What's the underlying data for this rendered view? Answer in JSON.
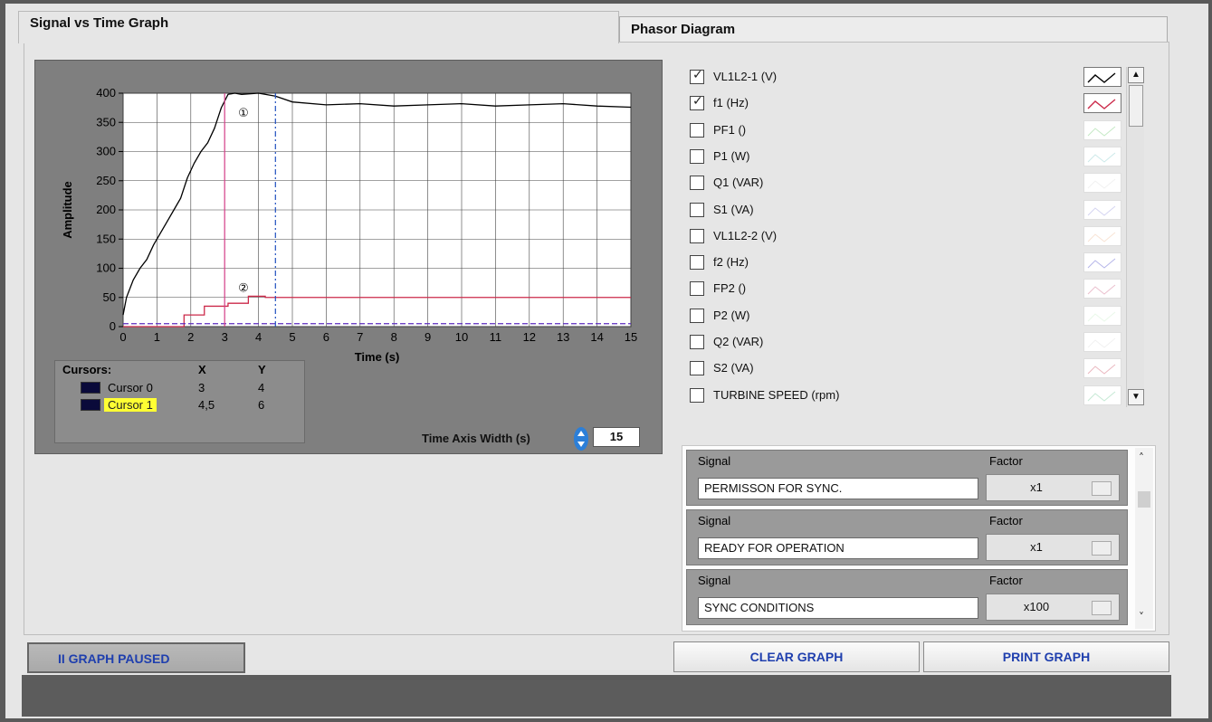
{
  "tabs": {
    "signal_vs_time": "Signal vs Time Graph",
    "phasor": "Phasor Diagram"
  },
  "graph": {
    "y_label": "Amplitude",
    "x_label": "Time (s)",
    "y_ticks": [
      "400",
      "350",
      "300",
      "250",
      "200",
      "150",
      "100",
      "50",
      "0"
    ],
    "x_ticks": [
      "0",
      "1",
      "2",
      "3",
      "4",
      "5",
      "6",
      "7",
      "8",
      "9",
      "10",
      "11",
      "12",
      "13",
      "14",
      "15"
    ],
    "marker1": "①",
    "marker2": "②"
  },
  "chart_data": {
    "type": "line",
    "xlabel": "Time (s)",
    "ylabel": "Amplitude",
    "xlim": [
      0,
      15
    ],
    "ylim": [
      0,
      400
    ],
    "grid": true,
    "series": [
      {
        "name": "VL1L2-1 (V)",
        "color": "#000000",
        "x": [
          0,
          0.1,
          0.3,
          0.5,
          0.7,
          0.9,
          1.1,
          1.3,
          1.5,
          1.7,
          1.9,
          2.1,
          2.3,
          2.5,
          2.7,
          2.9,
          3.1,
          3.3,
          3.5,
          4.0,
          4.5,
          5.0,
          6.0,
          7.0,
          8.0,
          9.0,
          10.0,
          11.0,
          12.0,
          13.0,
          14.0,
          15.0
        ],
        "y": [
          20,
          50,
          80,
          100,
          115,
          140,
          160,
          180,
          200,
          220,
          255,
          280,
          300,
          315,
          340,
          375,
          398,
          400,
          398,
          400,
          395,
          385,
          380,
          382,
          378,
          380,
          382,
          378,
          380,
          382,
          378,
          376
        ]
      },
      {
        "name": "f1 (Hz)",
        "color": "#cc2a4a",
        "x": [
          0,
          1.8,
          1.8,
          2.4,
          2.4,
          3.1,
          3.1,
          3.7,
          3.7,
          4.2,
          4.2,
          15
        ],
        "y": [
          0,
          0,
          20,
          20,
          35,
          35,
          40,
          40,
          52,
          52,
          50,
          50
        ]
      },
      {
        "name": "PF1 ()",
        "color": "#5b2bbf",
        "x": [
          0,
          15
        ],
        "y": [
          5,
          5
        ]
      }
    ]
  },
  "cursors": {
    "title": "Cursors:",
    "col_x": "X",
    "col_y": "Y",
    "rows": [
      {
        "name": "Cursor 0",
        "x": "3",
        "y": "4"
      },
      {
        "name": "Cursor 1",
        "x": "4,5",
        "y": "6"
      }
    ]
  },
  "time_axis": {
    "label": "Time Axis Width (s)",
    "value": "15"
  },
  "signals": [
    {
      "label": "VL1L2-1 (V)",
      "checked": true
    },
    {
      "label": "f1 (Hz)",
      "checked": true
    },
    {
      "label": "PF1 ()",
      "checked": false
    },
    {
      "label": "P1 (W)",
      "checked": false
    },
    {
      "label": "Q1 (VAR)",
      "checked": false
    },
    {
      "label": "S1 (VA)",
      "checked": false
    },
    {
      "label": "VL1L2-2 (V)",
      "checked": false
    },
    {
      "label": "f2 (Hz)",
      "checked": false
    },
    {
      "label": "FP2 ()",
      "checked": false
    },
    {
      "label": "P2 (W)",
      "checked": false
    },
    {
      "label": "Q2 (VAR)",
      "checked": false
    },
    {
      "label": "S2 (VA)",
      "checked": false
    },
    {
      "label": "TURBINE SPEED (rpm)",
      "checked": false
    }
  ],
  "legend_colors": [
    "#000000",
    "#cc2a4a",
    "#7fcf7f",
    "#8fcfcf",
    "#e0e0e0",
    "#9f9fdf",
    "#efc0a0",
    "#5a5acf",
    "#d07090",
    "#cfefcf",
    "#e0e0e0",
    "#d06070",
    "#7fcf9f"
  ],
  "signal_array": {
    "signal_label": "Signal",
    "factor_label": "Factor",
    "items": [
      {
        "signal": "PERMISSON FOR SYNC.",
        "factor": "x1"
      },
      {
        "signal": "READY FOR OPERATION",
        "factor": "x1"
      },
      {
        "signal": "SYNC CONDITIONS",
        "factor": "x100"
      }
    ]
  },
  "buttons": {
    "paused": "II    GRAPH PAUSED",
    "clear": "CLEAR GRAPH",
    "print": "PRINT GRAPH"
  }
}
